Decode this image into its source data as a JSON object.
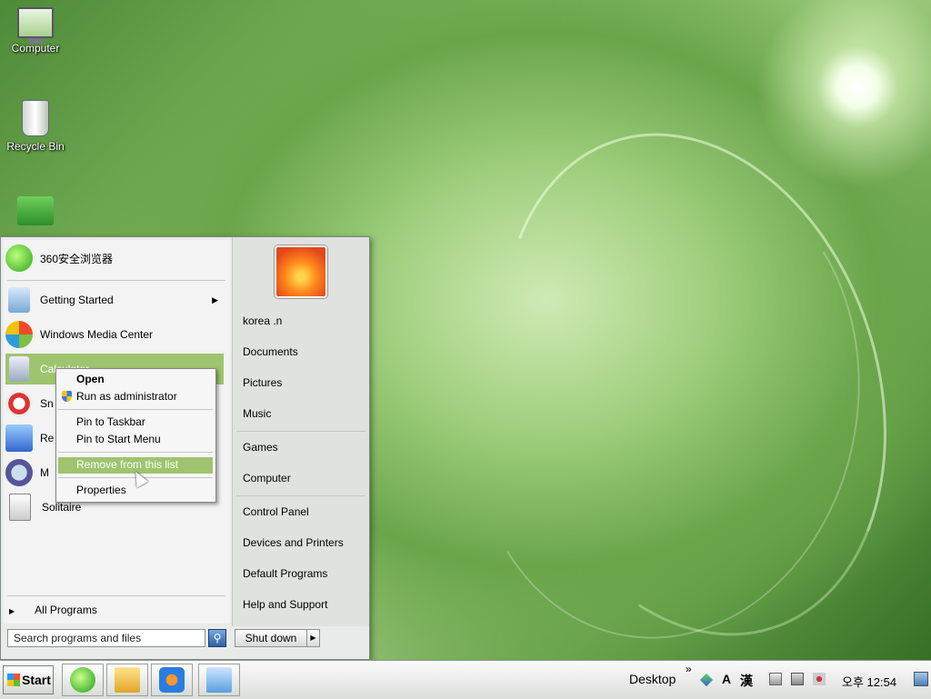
{
  "desktop": {
    "icons": [
      {
        "label": "Computer",
        "icon": "computer-icon"
      },
      {
        "label": "Recycle Bin",
        "icon": "recycle-bin-icon"
      },
      {
        "label": "",
        "icon": "folder-icon"
      }
    ]
  },
  "start_menu": {
    "pinned": {
      "label": "360安全浏览器",
      "icon": "browser-360-icon"
    },
    "recent": [
      {
        "label": "Getting Started",
        "icon": "getting-started-icon",
        "has_submenu": true
      },
      {
        "label": "Windows Media Center",
        "icon": "media-center-icon"
      },
      {
        "label": "Calculator",
        "icon": "calculator-icon",
        "highlighted": true
      },
      {
        "label": "Sn",
        "icon": "snipping-tool-icon"
      },
      {
        "label": "Re",
        "icon": "remote-desktop-icon"
      },
      {
        "label": "M",
        "icon": "magnifier-icon"
      },
      {
        "label": "Solitaire",
        "icon": "solitaire-icon"
      }
    ],
    "all_programs": "All Programs",
    "search_placeholder": "Search programs and files",
    "shutdown_label": "Shut down",
    "right_links": [
      "korea .n",
      "Documents",
      "Pictures",
      "Music",
      "Games",
      "Computer",
      "Control Panel",
      "Devices and Printers",
      "Default Programs",
      "Help and Support"
    ]
  },
  "context_menu": {
    "items": [
      {
        "label": "Open",
        "bold": true
      },
      {
        "label": "Run as administrator",
        "icon": "uac-shield-icon"
      },
      {
        "label": "Pin to Taskbar"
      },
      {
        "label": "Pin to Start Menu"
      },
      {
        "label": "Remove from this list",
        "highlighted": true
      },
      {
        "label": "Properties"
      }
    ]
  },
  "taskbar": {
    "start_label": "Start",
    "pinned_apps": [
      "ie-icon",
      "explorer-icon",
      "media-player-icon",
      "control-panel-icon"
    ],
    "toolbar_label": "Desktop",
    "chevron": "»",
    "ime_a": "A",
    "ime_han": "漢",
    "clock": "오후 12:54"
  },
  "colors": {
    "highlight": "#9fc46f",
    "menu_bg": "#f2f3f2"
  }
}
